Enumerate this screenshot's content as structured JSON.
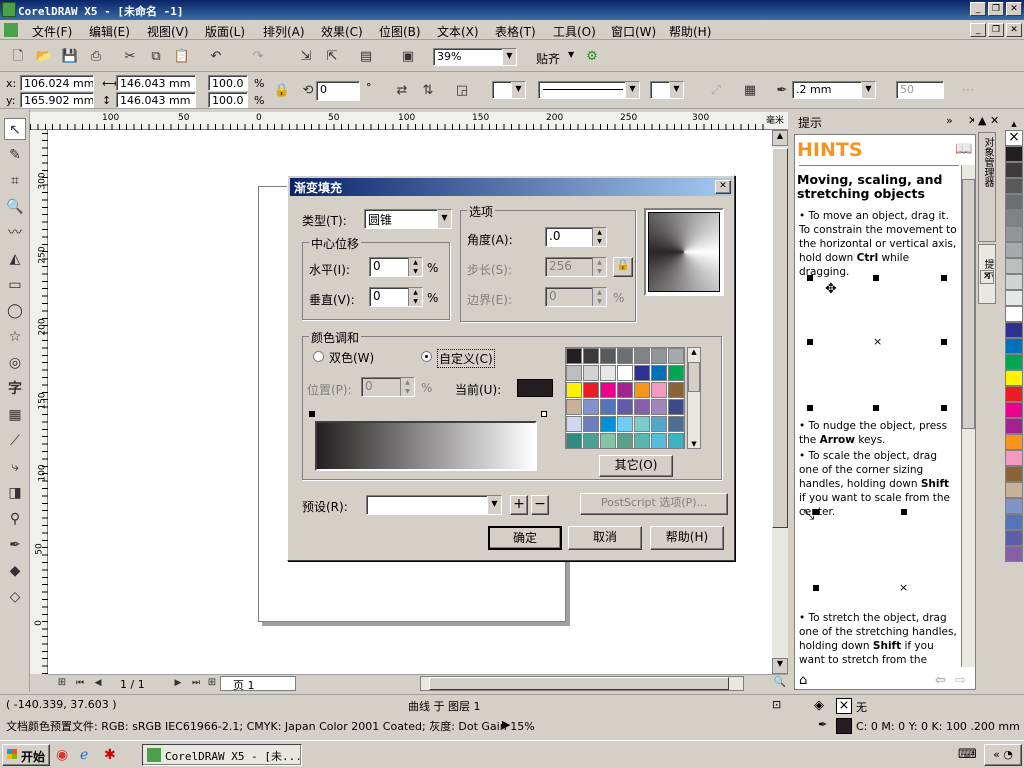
{
  "app": {
    "title": "CorelDRAW X5 - [未命名 -1]"
  },
  "menu": [
    "文件(F)",
    "编辑(E)",
    "视图(V)",
    "版面(L)",
    "排列(A)",
    "效果(C)",
    "位图(B)",
    "文本(X)",
    "表格(T)",
    "工具(O)",
    "窗口(W)",
    "帮助(H)"
  ],
  "std": {
    "zoom": "39%",
    "snap": "贴齐"
  },
  "prop": {
    "x": "106.024 mm",
    "y": "165.902 mm",
    "w": "146.043 mm",
    "h": "146.043 mm",
    "sx": "100.0",
    "sy": "100.0",
    "pct": "%",
    "angle": "0",
    "deg": "°",
    "outline": ".2 mm",
    "smooth": "50"
  },
  "rulers": {
    "h": [
      "100",
      "50",
      "0",
      "50",
      "100",
      "150",
      "200",
      "250",
      "300"
    ],
    "v": [
      "300",
      "250",
      "200",
      "150",
      "100",
      "50",
      "0"
    ],
    "unit": "毫米"
  },
  "hscroll": {
    "page": "1 / 1",
    "tab": "页 1"
  },
  "docker": {
    "title": "提示",
    "heading": "HINTS",
    "subheading": "Moving, scaling, and stretching objects",
    "side_tabs": [
      "对象管理器",
      "提示"
    ]
  },
  "dialog": {
    "title": "渐变填充",
    "type_label": "类型(T):",
    "type_value": "圆锥",
    "center_group": "中心位移",
    "h_label": "水平(I):",
    "h_value": "0",
    "v_label": "垂直(V):",
    "v_value": "0",
    "pct": "%",
    "options_group": "选项",
    "angle_label": "角度(A):",
    "angle_value": ".0",
    "steps_label": "步长(S):",
    "steps_value": "256",
    "edge_label": "边界(E):",
    "edge_value": "0",
    "blend_group": "颜色调和",
    "two_color": "双色(W)",
    "custom": "自定义(C)",
    "pos_label": "位置(P):",
    "pos_value": "0",
    "current_label": "当前(U):",
    "others_btn": "其它(O)",
    "preset_label": "预设(R):",
    "postscript_btn": "PostScript 选项(P)...",
    "ok": "确定",
    "cancel": "取消",
    "help": "帮助(H)",
    "palette": [
      "#231f20",
      "#3c3a3b",
      "#58595b",
      "#6d6e70",
      "#808285",
      "#939598",
      "#a7a9ac",
      "#bcbec0",
      "#d1d3d4",
      "#e6e7e8",
      "#ffffff",
      "#2e3192",
      "#0072bc",
      "#00a651",
      "#fff200",
      "#ed1c24",
      "#ec008c",
      "#a3228e",
      "#f7941d",
      "#f49ac1",
      "#8c6239",
      "#c7b299",
      "#8393ca",
      "#5674b9",
      "#605ca8",
      "#8560a8",
      "#a186be",
      "#3a4a8a",
      "#cfd8ef",
      "#6e7dbb",
      "#0091d8",
      "#6dcff6",
      "#7accc8",
      "#51a8c7",
      "#4c6e91",
      "#2f8a82",
      "#4aa195",
      "#82c4a8",
      "#5a9f8a",
      "#56b7b1",
      "#55bddb",
      "#3bb3c3"
    ]
  },
  "hints": [
    {
      "pre": "To move an object, drag it. To constrain the movement to the horizontal or vertical axis, hold down ",
      "bold": "Ctrl",
      "post": " while dragging."
    },
    {
      "pre": "To nudge the object, press the ",
      "bold": "Arrow",
      "post": " keys."
    },
    {
      "pre": "To scale the object, drag one of the corner sizing handles, holding down ",
      "bold": "Shift",
      "post": " if you want to scale from the center."
    },
    {
      "pre": "To stretch the object, drag one of the stretching handles, holding down ",
      "bold": "Shift",
      "post": " if you want to stretch from the"
    }
  ],
  "palette_colors": [
    "#ffffff",
    "#231f20",
    "#3c3a3b",
    "#58595b",
    "#6d6e70",
    "#808285",
    "#939598",
    "#a7a9ac",
    "#bcbec0",
    "#d1d3d4",
    "#e6e7e8",
    "#ffffff",
    "#2e3192",
    "#0072bc",
    "#00a651",
    "#fff200",
    "#ed1c24",
    "#ec008c",
    "#a3228e",
    "#f7941d",
    "#f49ac1",
    "#8c6239",
    "#c7b299",
    "#8393ca",
    "#5674b9",
    "#605ca8",
    "#8560a8"
  ],
  "status": {
    "coords": "( -140.339, 37.603 )",
    "info": "曲线 于 图层 1",
    "profile": "文档颜色预置文件: RGB: sRGB IEC61966-2.1; CMYK: Japan Color 2001 Coated; 灰度: Dot Gain 15%",
    "fill": "无",
    "outline": "C: 0 M: 0 Y: 0 K: 100  .200 mm"
  },
  "taskbar": {
    "start": "开始",
    "task": "CorelDRAW X5 - [未..."
  }
}
